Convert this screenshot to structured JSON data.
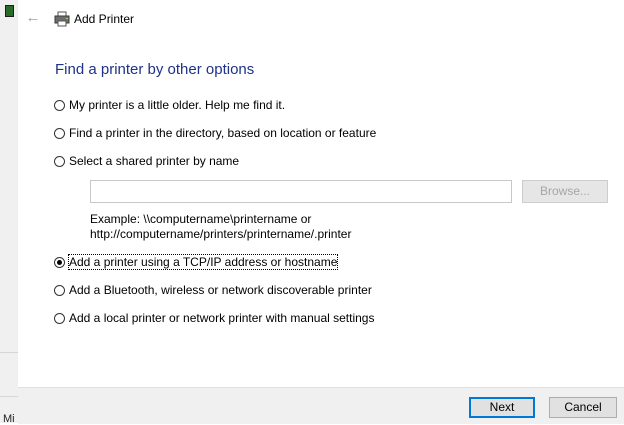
{
  "window": {
    "title": "Add Printer"
  },
  "background": {
    "partial_text": "Mi"
  },
  "page": {
    "heading": "Find a printer by other options"
  },
  "options": [
    {
      "label": "My printer is a little older. Help me find it.",
      "accel": "p",
      "checked": false
    },
    {
      "label": "Find a printer in the directory, based on location or feature",
      "accel": "i",
      "checked": false
    },
    {
      "label": "Select a shared printer by name",
      "accel": "S",
      "checked": false
    },
    {
      "label": "Add a printer using a TCP/IP address or hostname",
      "accel": "T",
      "checked": true
    },
    {
      "label": "Add a Bluetooth, wireless or network discoverable printer",
      "accel": "l",
      "checked": false
    },
    {
      "label": "Add a local printer or network printer with manual settings",
      "accel": "o",
      "checked": false
    }
  ],
  "shared_printer": {
    "value": "",
    "browse_label": "Browse...",
    "example_line1": "Example: \\\\computername\\printername or",
    "example_line2": "http://computername/printers/printername/.printer"
  },
  "footer": {
    "next_label": "Next",
    "cancel_label": "Cancel"
  }
}
